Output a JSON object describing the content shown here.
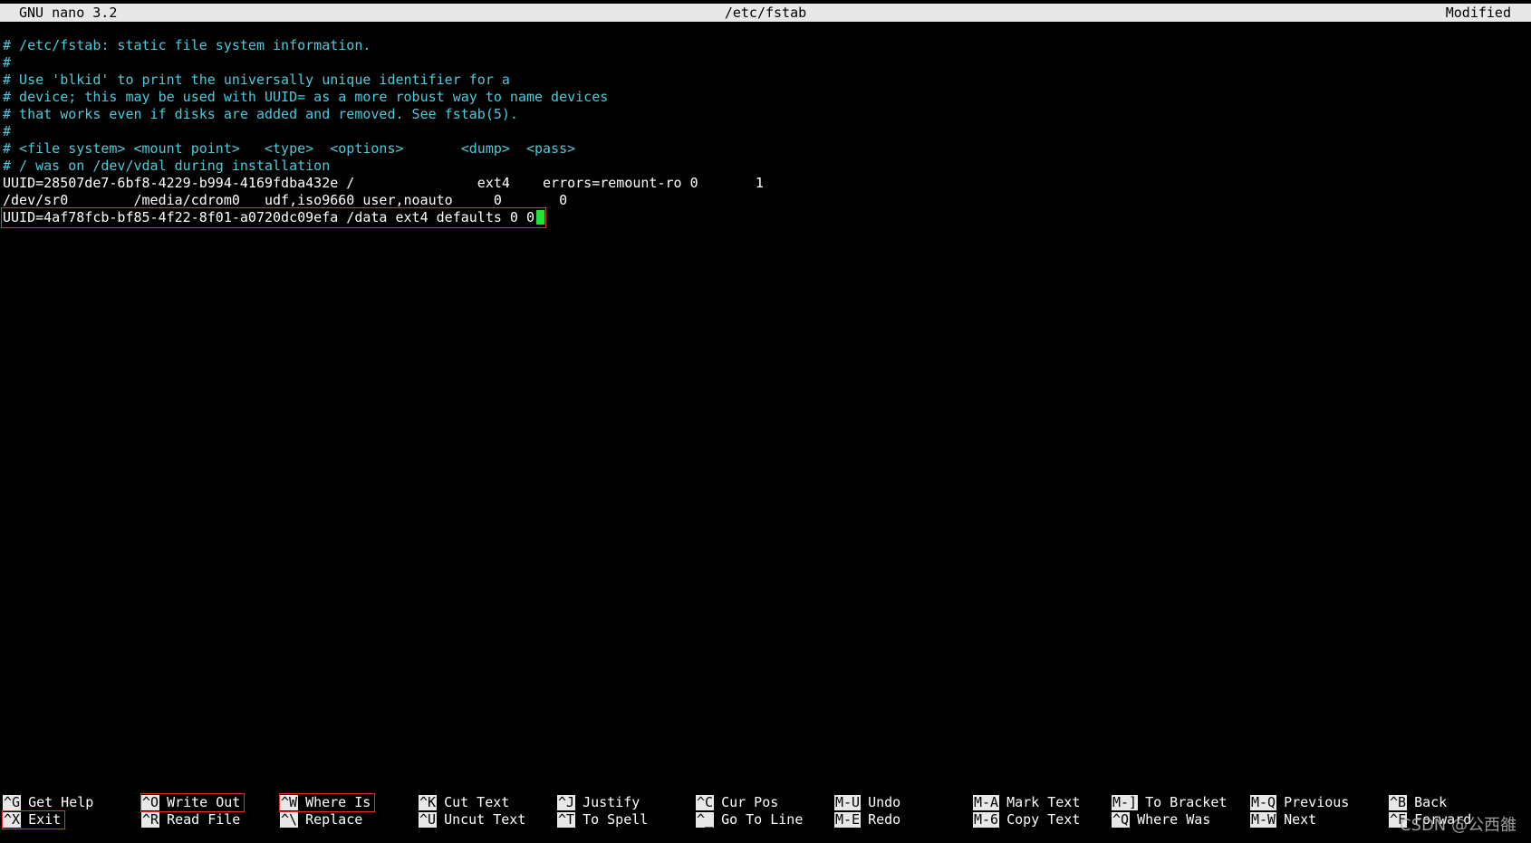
{
  "titlebar": {
    "app": "GNU nano 3.2",
    "file": "/etc/fstab",
    "status": "Modified"
  },
  "editor": {
    "lines": [
      "# /etc/fstab: static file system information.",
      "#",
      "# Use 'blkid' to print the universally unique identifier for a",
      "# device; this may be used with UUID= as a more robust way to name devices",
      "# that works even if disks are added and removed. See fstab(5).",
      "#",
      "# <file system> <mount point>   <type>  <options>       <dump>  <pass>",
      "# / was on /dev/vdal during installation",
      "UUID=28507de7-6bf8-4229-b994-4169fdba432e /               ext4    errors=remount-ro 0       1",
      "/dev/sr0        /media/cdrom0   udf,iso9660 user,noauto     0       0",
      "UUID=4af78fcb-bf85-4f22-8f01-a0720dc09efa /data ext4 defaults 0 0"
    ],
    "colors": {
      "comment": "#4fc9d9",
      "text": "#ffffff",
      "cursor": "#22e23a",
      "highlight": "#e8302a"
    }
  },
  "shortcuts": {
    "columns": [
      [
        {
          "key": "^G",
          "label": "Get Help"
        },
        {
          "key": "^X",
          "label": "Exit"
        }
      ],
      [
        {
          "key": "^O",
          "label": "Write Out"
        },
        {
          "key": "^R",
          "label": "Read File"
        }
      ],
      [
        {
          "key": "^W",
          "label": "Where Is"
        },
        {
          "key": "^\\",
          "label": "Replace"
        }
      ],
      [
        {
          "key": "^K",
          "label": "Cut Text"
        },
        {
          "key": "^U",
          "label": "Uncut Text"
        }
      ],
      [
        {
          "key": "^J",
          "label": "Justify"
        },
        {
          "key": "^T",
          "label": "To Spell"
        }
      ],
      [
        {
          "key": "^C",
          "label": "Cur Pos"
        },
        {
          "key": "^_",
          "label": "Go To Line"
        }
      ],
      [
        {
          "key": "M-U",
          "label": "Undo"
        },
        {
          "key": "M-E",
          "label": "Redo"
        }
      ],
      [
        {
          "key": "M-A",
          "label": "Mark Text"
        },
        {
          "key": "M-6",
          "label": "Copy Text"
        }
      ],
      [
        {
          "key": "M-]",
          "label": "To Bracket"
        },
        {
          "key": "^Q",
          "label": "Where Was"
        }
      ],
      [
        {
          "key": "M-Q",
          "label": "Previous"
        },
        {
          "key": "M-W",
          "label": "Next"
        }
      ],
      [
        {
          "key": "^B",
          "label": "Back"
        },
        {
          "key": "^F",
          "label": "Forward"
        }
      ]
    ]
  },
  "watermark": "CSDN @公西雒"
}
